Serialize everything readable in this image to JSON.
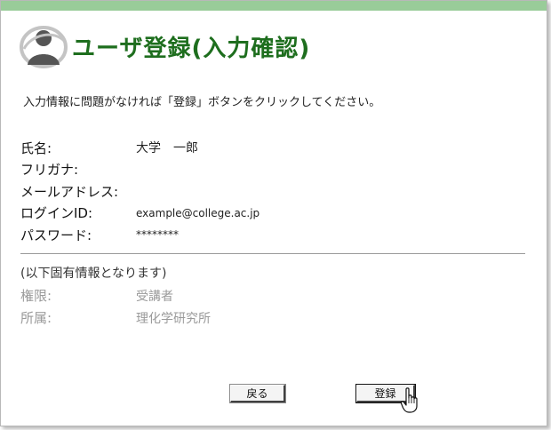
{
  "colors": {
    "accent": "#99cc99",
    "title": "#1e6e1e",
    "logo_dark": "#555555",
    "logo_light": "#c4c4c4",
    "muted": "#9a9a9a"
  },
  "header": {
    "logo_icon": "user-silhouette-icon",
    "title": "ユーザ登録(入力確認)"
  },
  "instructions": "入力情報に問題がなければ「登録」ボタンをクリックしてください。",
  "fields": [
    {
      "label": "氏名:",
      "value": "大学　一郎"
    },
    {
      "label": "フリガナ:",
      "value": ""
    },
    {
      "label": "メールアドレス:",
      "value": ""
    },
    {
      "label": "ログインID:",
      "value": "example@college.ac.jp"
    },
    {
      "label": "パスワード:",
      "value": "********"
    }
  ],
  "fixed_info": {
    "note": "(以下固有情報となります)",
    "items": [
      {
        "label": "権限:",
        "value": "受講者"
      },
      {
        "label": "所属:",
        "value": "理化学研究所"
      }
    ]
  },
  "buttons": {
    "back_label": "戻る",
    "register_label": "登録"
  },
  "cursor_icon": "hand-pointer-icon"
}
